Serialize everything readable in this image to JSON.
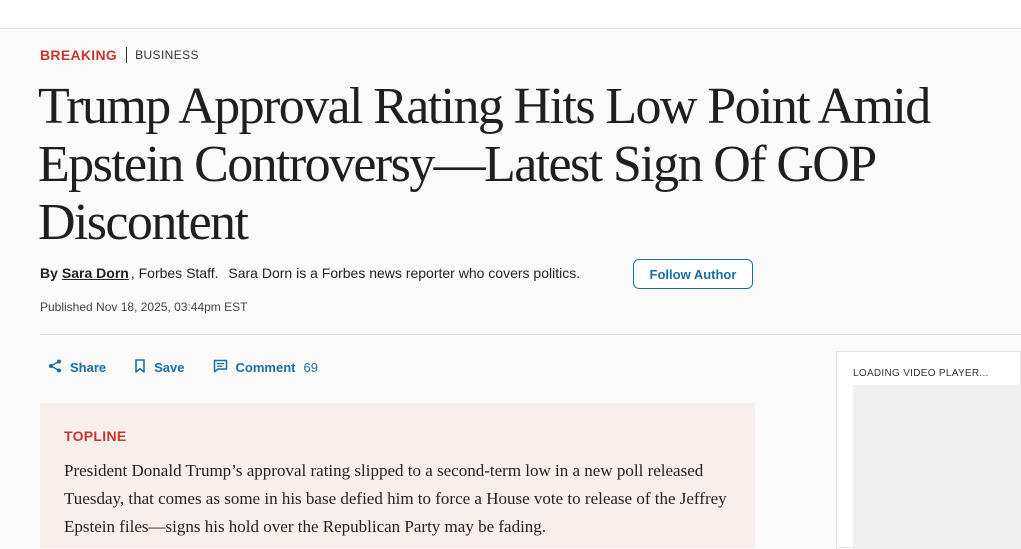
{
  "kicker": {
    "label": "BREAKING",
    "section": "BUSINESS"
  },
  "headline": "Trump Approval Rating Hits Low Point Amid Epstein Controversy—Latest Sign Of GOP Discontent",
  "byline": {
    "by": "By",
    "author": "Sara Dorn",
    "staff": ", Forbes Staff.",
    "description": "Sara Dorn is a Forbes news reporter who covers politics.",
    "follow_label": "Follow Author"
  },
  "published": "Published Nov 18, 2025, 03:44pm EST",
  "actions": {
    "share": "Share",
    "save": "Save",
    "comment": "Comment",
    "comment_count": "69"
  },
  "topline": {
    "label": "TOPLINE",
    "text": "President Donald Trump’s approval rating slipped to a second-term low in a new poll released Tuesday, that comes as some in his base defied him to force a House vote to release of the Jeffrey Epstein files—signs his hold over the Republican Party may be fading."
  },
  "video": {
    "loading_label": "LOADING VIDEO PLAYER..."
  },
  "colors": {
    "accent_red": "#c8372d",
    "link_blue": "#1a6ea0",
    "topline_bg": "#f8eeec"
  }
}
